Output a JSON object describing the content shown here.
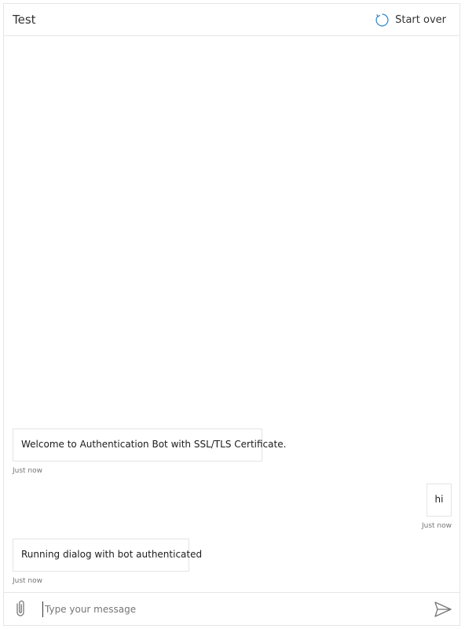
{
  "header": {
    "title": "Test",
    "start_over_label": "Start over",
    "restart_icon": "refresh-icon",
    "accent_color": "#3a8fd0"
  },
  "transcript": {
    "messages": [
      {
        "from": "bot",
        "text": "Welcome to Authentication Bot with SSL/TLS Certificate.",
        "timestamp": "Just now"
      },
      {
        "from": "user",
        "text": "hi",
        "timestamp": "Just now"
      },
      {
        "from": "bot",
        "text": "Running dialog with bot authenticated",
        "timestamp": "Just now"
      }
    ]
  },
  "composer": {
    "placeholder": "Type your message",
    "value": "",
    "attach_icon": "paperclip-icon",
    "send_icon": "send-icon"
  }
}
